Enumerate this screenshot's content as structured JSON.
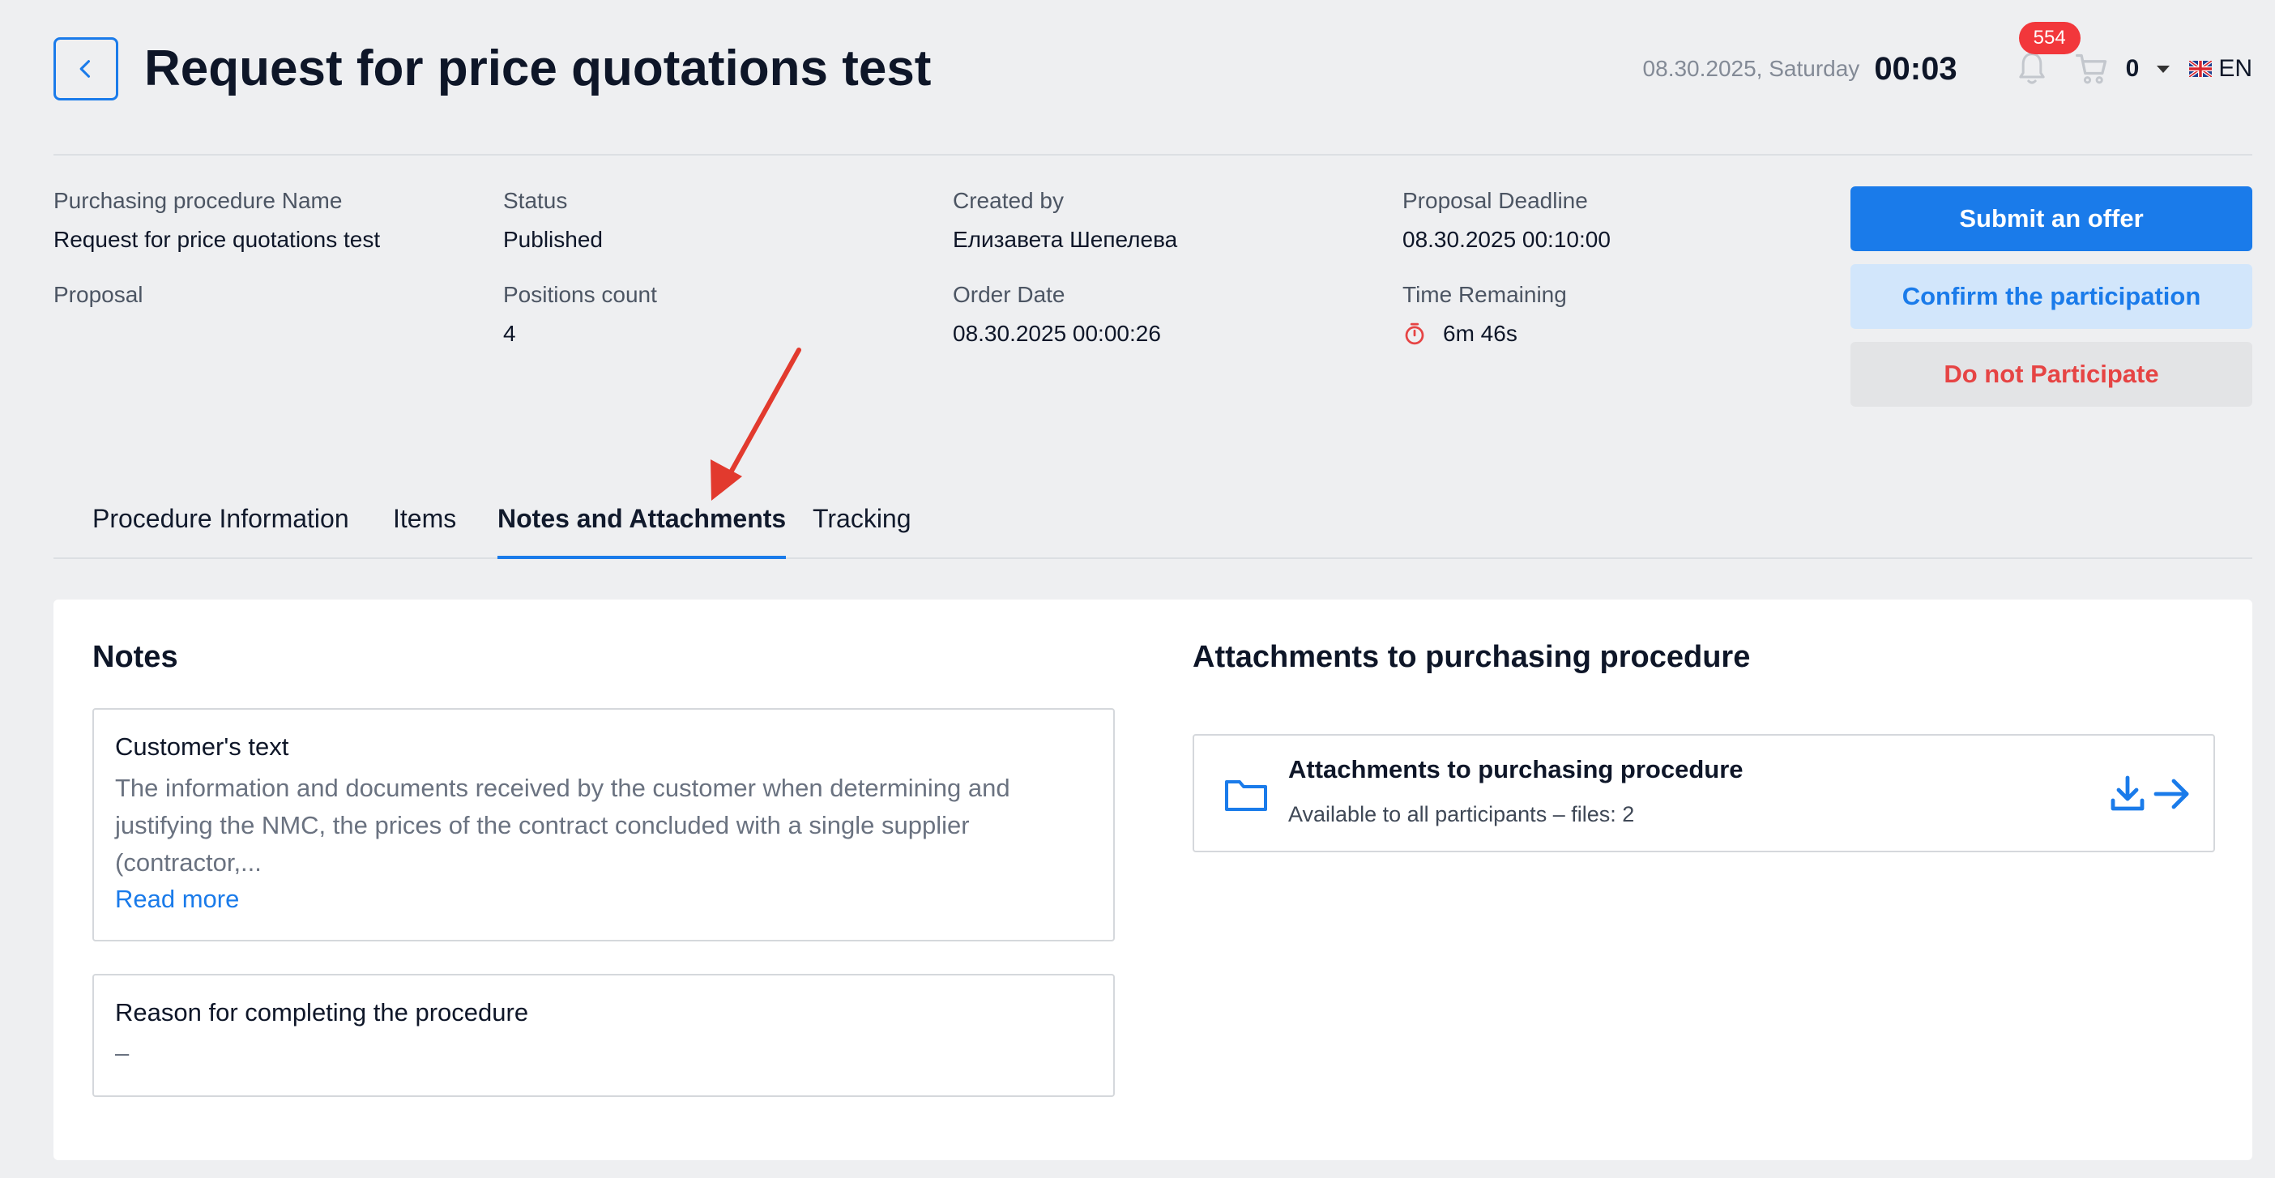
{
  "header": {
    "title": "Request for price quotations test",
    "date": "08.30.2025, Saturday",
    "time": "00:03",
    "notification_count": "554",
    "cart_count": "0",
    "language": "EN"
  },
  "info": {
    "name_label": "Purchasing procedure Name",
    "name_value": "Request for price quotations test",
    "status_label": "Status",
    "status_value": "Published",
    "created_label": "Created by",
    "created_value": "Елизавета Шепелева",
    "deadline_label": "Proposal Deadline",
    "deadline_value": "08.30.2025 00:10:00",
    "proposal_label": "Proposal",
    "positions_label": "Positions count",
    "positions_value": "4",
    "order_label": "Order Date",
    "order_value": "08.30.2025 00:00:26",
    "remaining_label": "Time Remaining",
    "remaining_value": "6m 46s"
  },
  "actions": {
    "submit": "Submit an offer",
    "confirm": "Confirm the participation",
    "decline": "Do not Participate"
  },
  "tabs": [
    {
      "label": "Procedure Information"
    },
    {
      "label": "Items"
    },
    {
      "label": "Notes and Attachments"
    },
    {
      "label": "Tracking"
    }
  ],
  "notes": {
    "title": "Notes",
    "customer_title": "Customer's text",
    "customer_line1": "The information and documents received by the customer when determining and",
    "customer_line2": "justifying the NMC, the prices of the contract concluded with a single supplier",
    "customer_line3": "(contractor,...",
    "read_more": "Read more",
    "reason_title": "Reason for completing the procedure",
    "reason_value": "–"
  },
  "attachments": {
    "section_title": "Attachments to purchasing procedure",
    "item_title": "Attachments to purchasing procedure",
    "item_subtitle": "Available to all participants – files: 2"
  },
  "colors": {
    "accent": "#1a7bea",
    "badge": "#f2373b",
    "danger": "#e64444",
    "annotation_arrow": "#e23a2e"
  }
}
